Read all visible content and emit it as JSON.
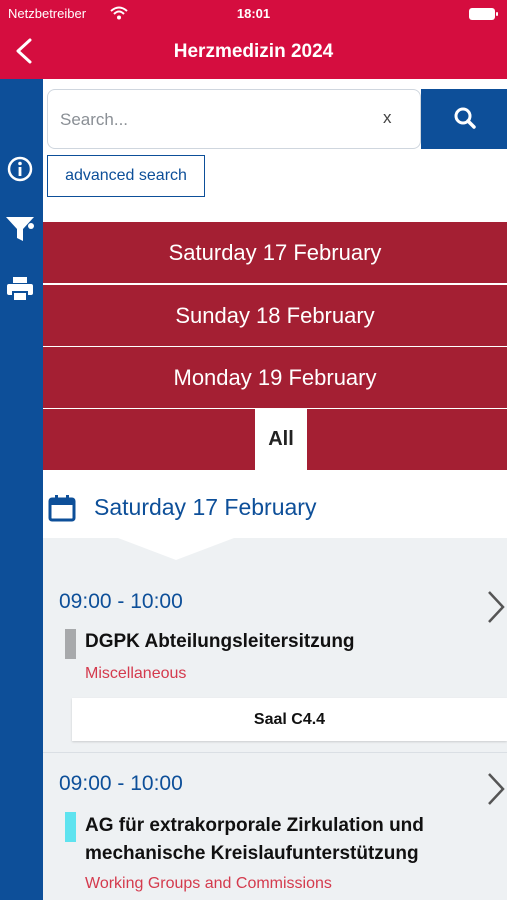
{
  "status_bar": {
    "carrier": "Netzbetreiber",
    "time": "18:01"
  },
  "header": {
    "title": "Herzmedizin 2024"
  },
  "sidebar": {
    "icons": [
      "info-icon",
      "filter-icon",
      "print-icon"
    ]
  },
  "search": {
    "placeholder": "Search...",
    "value": "",
    "clear_label": "x",
    "advanced_label": "advanced search"
  },
  "days": {
    "items": [
      "Saturday 17 February",
      "Sunday 18 February",
      "Monday 19 February"
    ],
    "all_label": "All",
    "selected": "All"
  },
  "current_date": "Saturday 17 February",
  "sessions": [
    {
      "time": "09:00 - 10:00",
      "title": "DGPK Abteilungsleitersitzung",
      "category": "Miscellaneous",
      "room": "Saal C4.4",
      "color": "#a7a9ab"
    },
    {
      "time": "09:00 - 10:00",
      "title": "AG für extrakorporale Zirkulation und mechanische Kreislaufunterstützung",
      "category": "Working Groups and Commissions",
      "color": "#5ee3ef"
    }
  ],
  "colors": {
    "brand_red": "#d50d3f",
    "day_red": "#a41f33",
    "brand_blue": "#0d4f99",
    "category_red": "#d43a4d",
    "list_bg": "#eef1f3"
  }
}
